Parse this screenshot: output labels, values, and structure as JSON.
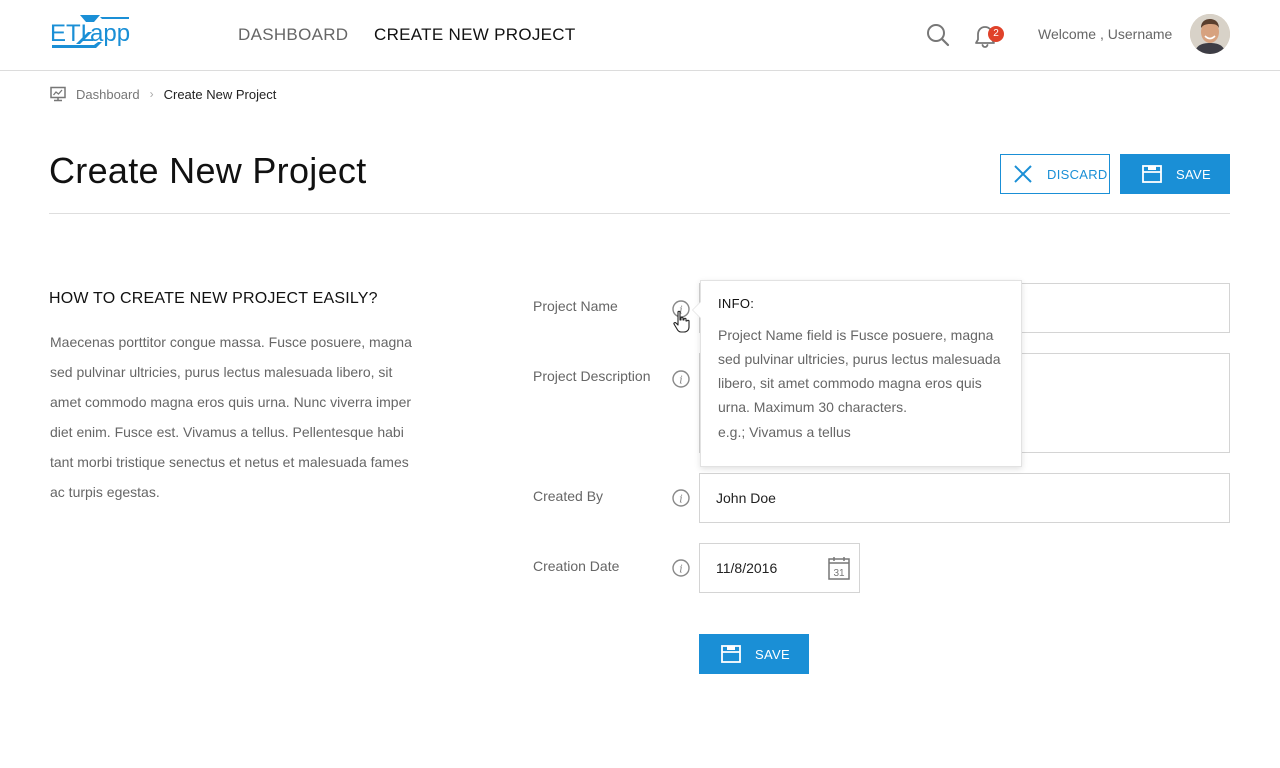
{
  "app": {
    "logo_text": "ETLapp"
  },
  "header": {
    "nav": [
      {
        "label": "DASHBOARD"
      },
      {
        "label": "CREATE NEW PROJECT"
      }
    ],
    "notifications_count": "2",
    "welcome_text": "Welcome , Username",
    "icons": {
      "search": "search-icon",
      "notifications": "bell-icon",
      "avatar": "user-avatar"
    }
  },
  "breadcrumb": {
    "home": "Dashboard",
    "current": "Create New Project"
  },
  "page": {
    "title": "Create New Project",
    "discard_label": "DISCARD",
    "save_label": "SAVE"
  },
  "help": {
    "title": "HOW TO CREATE NEW PROJECT EASILY?",
    "text": "Maecenas porttitor congue massa. Fusce posuere, magna sed pulvinar ultricies, purus lectus malesuada libero, sit amet commodo magna eros quis urna. Nunc viverra imper diet enim. Fusce est. Vivamus a tellus. Pellentesque habi tant morbi tristique senectus et netus et malesuada fames ac turpis egestas."
  },
  "form": {
    "project_name": {
      "label": "Project Name",
      "value": ""
    },
    "project_description": {
      "label": "Project Description",
      "value": ""
    },
    "created_by": {
      "label": "Created By",
      "value": "John Doe"
    },
    "creation_date": {
      "label": "Creation Date",
      "value": "11/8/2016",
      "calendar_day": "31"
    },
    "save_label": "SAVE"
  },
  "tooltip": {
    "title": "INFO:",
    "body": "Project Name field is  Fusce posuere, magna sed pulvinar ultricies, purus lectus malesuada libero, sit amet commodo magna eros quis urna. Maximum 30 characters.",
    "example": "e.g.; Vivamus a tellus"
  },
  "colors": {
    "accent": "#1a8fd6",
    "badge": "#e0422a",
    "text_muted": "#666666"
  }
}
